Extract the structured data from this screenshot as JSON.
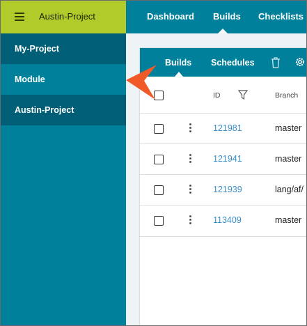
{
  "header": {
    "project_title": "Austin-Project",
    "tabs": [
      {
        "label": "Dashboard"
      },
      {
        "label": "Builds"
      },
      {
        "label": "Checklists"
      }
    ]
  },
  "sidebar": {
    "items": [
      {
        "label": "My-Project"
      },
      {
        "label": "Module"
      },
      {
        "label": "Austin-Project"
      }
    ]
  },
  "panel": {
    "tabs": [
      {
        "label": "Builds"
      },
      {
        "label": "Schedules"
      }
    ],
    "columns": {
      "id": "ID",
      "branch": "Branch"
    },
    "rows": [
      {
        "id": "121981",
        "branch": "master"
      },
      {
        "id": "121941",
        "branch": "master"
      },
      {
        "id": "121939",
        "branch": "lang/af/"
      },
      {
        "id": "113409",
        "branch": "master"
      }
    ]
  },
  "colors": {
    "brand_green": "#b0cb2a",
    "teal": "#00809b",
    "teal_dark": "#005f76",
    "link_blue": "#3b8fc8",
    "annotation_orange": "#f05a28"
  },
  "icons": [
    "hamburger-icon",
    "trash-icon",
    "gear-icon",
    "filter-icon",
    "kebab-icon"
  ]
}
